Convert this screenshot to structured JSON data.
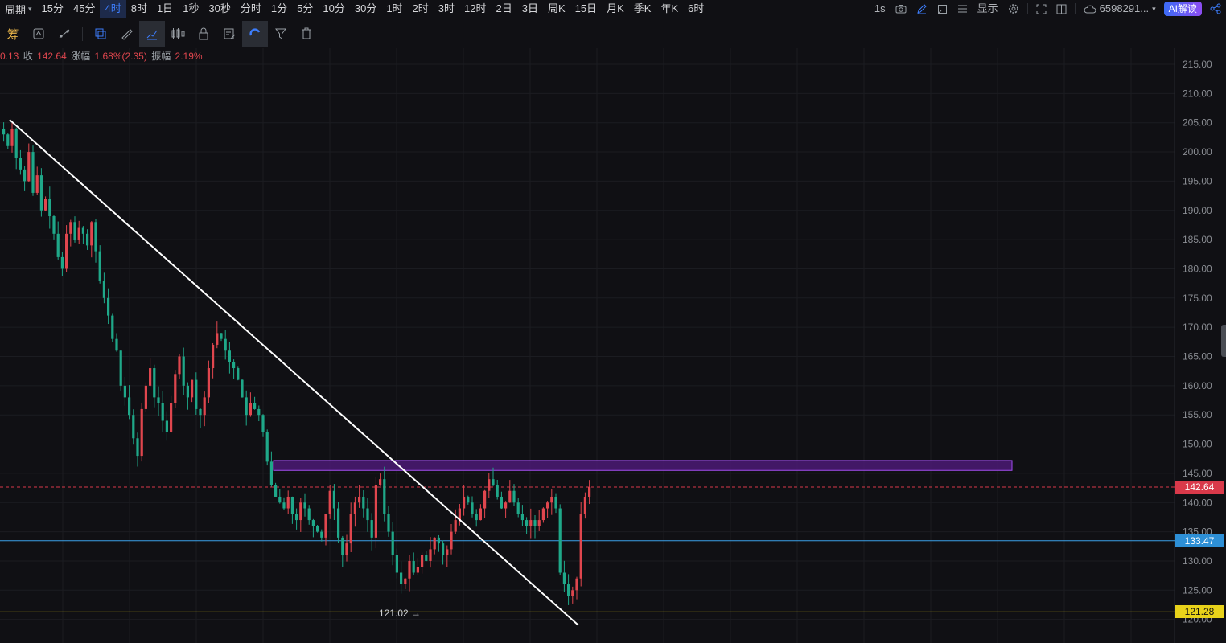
{
  "topbar": {
    "period_label": "周期",
    "timeframes": [
      "15分",
      "45分",
      "4时",
      "8时",
      "1日",
      "1秒",
      "30秒",
      "分时",
      "1分",
      "5分",
      "10分",
      "30分",
      "1时",
      "2时",
      "3时",
      "12时",
      "2日",
      "3日",
      "周K",
      "15日",
      "月K",
      "季K",
      "年K",
      "6时"
    ],
    "active_timeframe": "4时",
    "speed": "1s",
    "display_label": "显示",
    "account": "6598291...",
    "ai_label": "AI解读"
  },
  "toolbar": {
    "chip_label": "筹"
  },
  "ohlc": {
    "prefix": "0.13",
    "close_label": "收",
    "close_value": "142.64",
    "change_label": "涨幅",
    "change_value": "1.68%(2.35)",
    "amplitude_label": "振幅",
    "amplitude_value": "2.19%"
  },
  "price_tags": {
    "current": "142.64",
    "blue_line": "133.47",
    "yellow_line": "121.28"
  },
  "annotations": {
    "low_label": "121.02 →"
  },
  "colors": {
    "up": "#e0464e",
    "down": "#1fa889",
    "rect": "#8a2be2",
    "blue_line": "#3aa0e8",
    "yellow_line": "#e8d21a",
    "current_tag": "#d9394a",
    "blue_tag": "#2d8fd6",
    "yellow_tag": "#e8d21a"
  },
  "chart_data": {
    "type": "candlestick",
    "y_ticks": [
      215,
      210,
      205,
      200,
      195,
      190,
      185,
      180,
      175,
      170,
      165,
      160,
      155,
      150,
      145,
      140,
      135,
      130,
      125,
      120
    ],
    "ylim": [
      119.5,
      216.5
    ],
    "grid": true,
    "horizontal_lines": [
      {
        "name": "current",
        "value": 142.64,
        "style": "dashed"
      },
      {
        "name": "blue",
        "value": 133.47,
        "style": "solid"
      },
      {
        "name": "yellow",
        "value": 121.28,
        "style": "solid"
      }
    ],
    "resistance_zone": [
      145.5,
      147.2
    ],
    "trendline": {
      "from": 205.5,
      "to": 119.0
    },
    "low_marker": 121.02,
    "closes": [
      203,
      201,
      204,
      199,
      197,
      195,
      200,
      193,
      196,
      190,
      192,
      189,
      186,
      182,
      180,
      186,
      188,
      185,
      187,
      186,
      184,
      188,
      183,
      178,
      175,
      172,
      168,
      166,
      160,
      158,
      155,
      151,
      148,
      156,
      160,
      163,
      158,
      157,
      154,
      152,
      157,
      162,
      165,
      160,
      158,
      161,
      156,
      155,
      158,
      163,
      167,
      169,
      168,
      166,
      164,
      163,
      161,
      158,
      155,
      157,
      156,
      155,
      152,
      147,
      143,
      141,
      140,
      139,
      141,
      138,
      137,
      140,
      139,
      137,
      136,
      135,
      134,
      138,
      142,
      139,
      134,
      131,
      133,
      138,
      140,
      141,
      139,
      137,
      134,
      143,
      144,
      138,
      135,
      131,
      128,
      126,
      127,
      130,
      128,
      129,
      131,
      130,
      132,
      134,
      133,
      131,
      132,
      135,
      137,
      139,
      141,
      140,
      138,
      137,
      139,
      142,
      144,
      143,
      141,
      139,
      140,
      142,
      140,
      138,
      137,
      136,
      137,
      136,
      137,
      139,
      140,
      141,
      139,
      128,
      126,
      124,
      125,
      127,
      138,
      141,
      142.64
    ]
  }
}
